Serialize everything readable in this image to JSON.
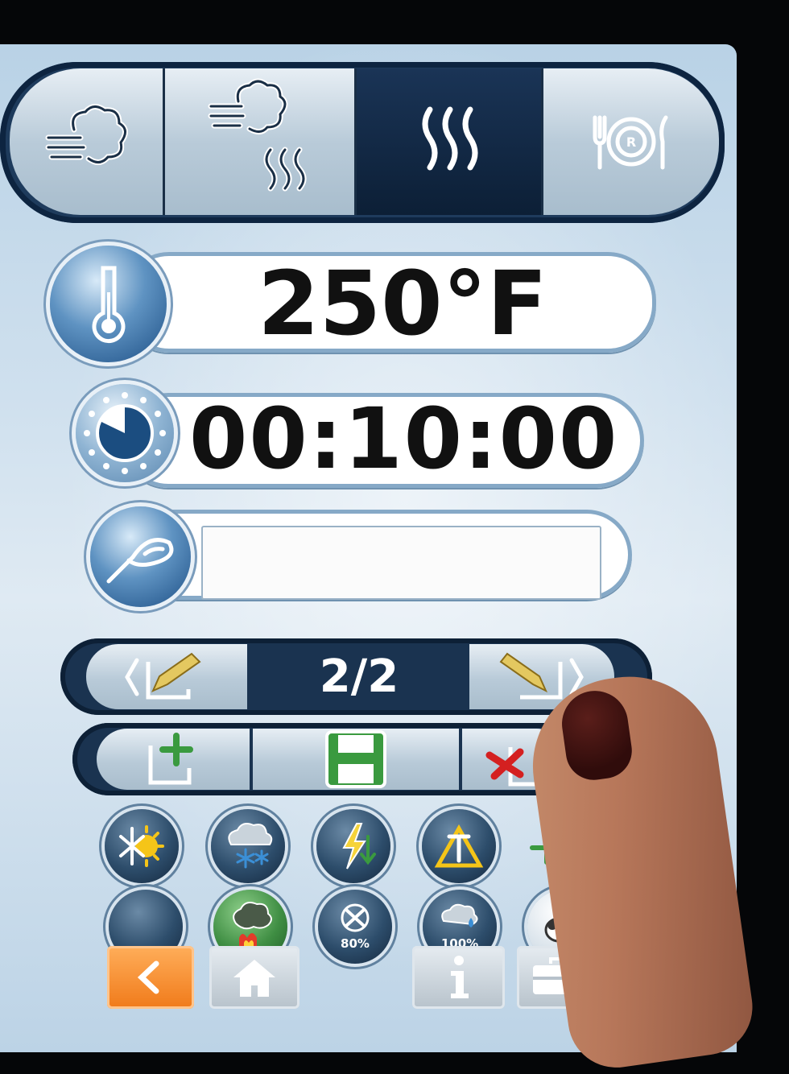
{
  "modes": [
    {
      "name": "steam",
      "icon": "steam-icon"
    },
    {
      "name": "combi",
      "icon": "steam-heat-icon"
    },
    {
      "name": "hot-air",
      "icon": "hot-air-icon",
      "selected": true
    },
    {
      "name": "regenerate",
      "icon": "plate-regenerate-icon"
    }
  ],
  "temperature": {
    "value": "250°F",
    "icon": "thermometer-icon"
  },
  "timer": {
    "value": "00:10:00",
    "icon": "timer-icon"
  },
  "probe": {
    "value": "",
    "icon": "core-probe-icon"
  },
  "program": {
    "step": "2/2",
    "prev_icon": "prev-step-edit-icon",
    "next_icon": "next-step-edit-icon"
  },
  "actions": [
    {
      "name": "add-step",
      "icon": "add-step-icon"
    },
    {
      "name": "save",
      "icon": "save-icon"
    },
    {
      "name": "delete-step",
      "icon": "delete-step-icon"
    }
  ],
  "functions_row1": [
    {
      "name": "cool-down",
      "icon": "sun-snowflake-icon"
    },
    {
      "name": "humidity-cold",
      "icon": "cloud-snow-icon"
    },
    {
      "name": "energy",
      "icon": "lightning-icon"
    },
    {
      "name": "delta-t",
      "icon": "delta-t-icon"
    },
    {
      "name": "more",
      "icon": "plus-more-icon"
    }
  ],
  "functions_row2": [
    {
      "name": "blank",
      "icon": "blank-icon"
    },
    {
      "name": "smoke",
      "icon": "smoke-icon"
    },
    {
      "name": "fan-speed",
      "icon": "fan-icon",
      "label": "80%"
    },
    {
      "name": "humidity",
      "icon": "humidity-icon",
      "label": "100%"
    },
    {
      "name": "dry",
      "icon": "dry-icon"
    }
  ],
  "bottom": [
    {
      "name": "back",
      "icon": "back-arrow-icon"
    },
    {
      "name": "home",
      "icon": "home-icon"
    },
    {
      "name": "info",
      "icon": "info-icon"
    },
    {
      "name": "tools",
      "icon": "toolbox-icon"
    }
  ],
  "colors": {
    "accent": "#f07a1a",
    "save": "#3a9a3f",
    "delete": "#d42020",
    "edit": "#e4c860"
  }
}
